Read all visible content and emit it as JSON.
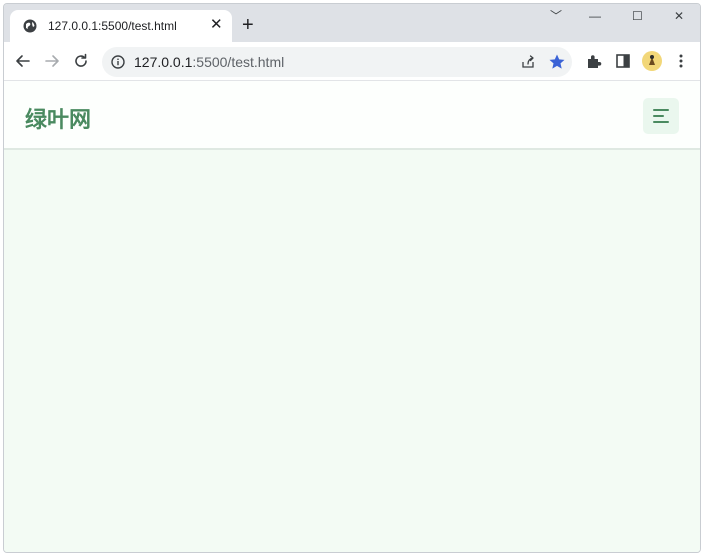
{
  "browser": {
    "tab": {
      "title": "127.0.0.1:5500/test.html",
      "close_glyph": "✕",
      "favicon": "globe-icon"
    },
    "new_tab_glyph": "+",
    "window_controls": {
      "dropdown": "﹀",
      "minimize": "—",
      "maximize": "☐",
      "close": "✕"
    },
    "address": {
      "host": "127.0.0.1",
      "path": ":5500/test.html"
    },
    "colors": {
      "star": "#3b63d6",
      "avatar": "#f2d779"
    }
  },
  "site": {
    "brand": "绿叶网",
    "menu_icon": "hamburger-menu-icon",
    "colors": {
      "brand": "#4a8a60",
      "background": "#f3fbf4",
      "navbar": "#fdfffd",
      "menu_button_bg": "#eaf7ee"
    }
  }
}
